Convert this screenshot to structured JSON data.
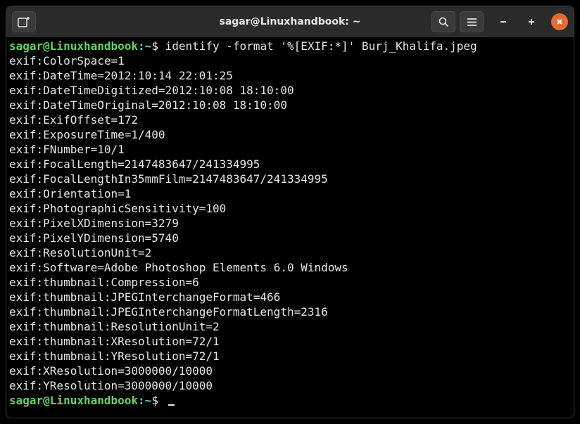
{
  "title": "sagar@Linuxhandbook: ~",
  "prompt": {
    "user_host": "sagar@Linuxhandbook",
    "sep": ":",
    "path": "~",
    "dollar": "$ "
  },
  "command": "identify -format '%[EXIF:*]' Burj_Khalifa.jpeg",
  "output_lines": [
    "exif:ColorSpace=1",
    "exif:DateTime=2012:10:14 22:01:25",
    "exif:DateTimeDigitized=2012:10:08 18:10:00",
    "exif:DateTimeOriginal=2012:10:08 18:10:00",
    "exif:ExifOffset=172",
    "exif:ExposureTime=1/400",
    "exif:FNumber=10/1",
    "exif:FocalLength=2147483647/241334995",
    "exif:FocalLengthIn35mmFilm=2147483647/241334995",
    "exif:Orientation=1",
    "exif:PhotographicSensitivity=100",
    "exif:PixelXDimension=3279",
    "exif:PixelYDimension=5740",
    "exif:ResolutionUnit=2",
    "exif:Software=Adobe Photoshop Elements 6.0 Windows",
    "exif:thumbnail:Compression=6",
    "exif:thumbnail:JPEGInterchangeFormat=466",
    "exif:thumbnail:JPEGInterchangeFormatLength=2316",
    "exif:thumbnail:ResolutionUnit=2",
    "exif:thumbnail:XResolution=72/1",
    "exif:thumbnail:YResolution=72/1",
    "exif:XResolution=3000000/10000",
    "exif:YResolution=3000000/10000"
  ],
  "icons": {
    "new_tab": "new-tab-icon",
    "search": "search-icon",
    "menu": "hamburger-icon",
    "minimize": "minimize-icon",
    "maximize": "maximize-icon",
    "close": "close-icon"
  }
}
